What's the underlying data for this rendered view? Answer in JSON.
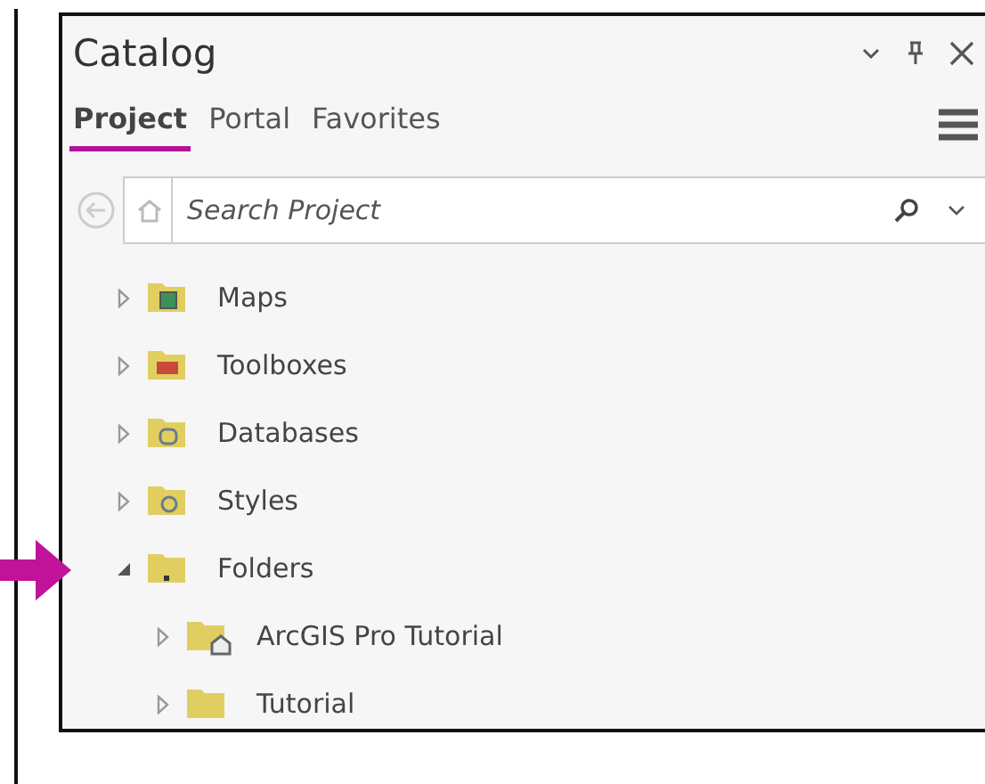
{
  "panel": {
    "title": "Catalog"
  },
  "tabs": [
    {
      "label": "Project",
      "selected": true
    },
    {
      "label": "Portal",
      "selected": false
    },
    {
      "label": "Favorites",
      "selected": false
    }
  ],
  "search": {
    "placeholder": "Search Project"
  },
  "tree": [
    {
      "label": "Maps",
      "kind": "maps",
      "expanded": false
    },
    {
      "label": "Toolboxes",
      "kind": "toolboxes",
      "expanded": false
    },
    {
      "label": "Databases",
      "kind": "databases",
      "expanded": false
    },
    {
      "label": "Styles",
      "kind": "styles",
      "expanded": false
    },
    {
      "label": "Folders",
      "kind": "folders",
      "expanded": true,
      "children": [
        {
          "label": "ArcGIS Pro Tutorial",
          "kind": "home",
          "expanded": false
        },
        {
          "label": "Tutorial",
          "kind": "folder",
          "expanded": false
        }
      ]
    }
  ]
}
